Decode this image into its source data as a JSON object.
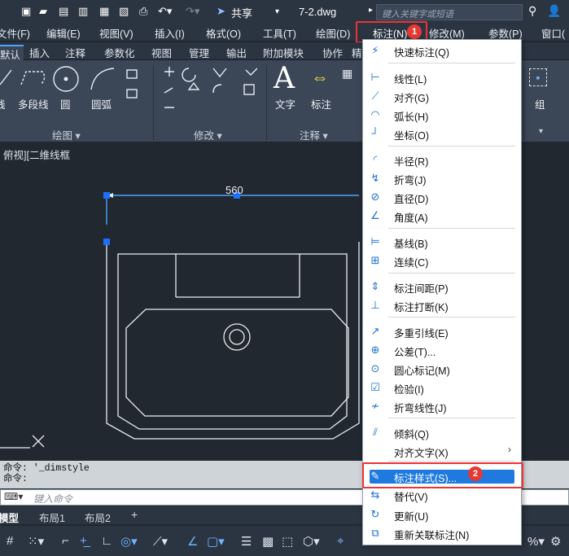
{
  "app": {
    "doc_title": "7-2.dwg",
    "share_label": "共享",
    "search_placeholder": "键入关键字或短语"
  },
  "menubar": [
    "文件(F)",
    "编辑(E)",
    "视图(V)",
    "插入(I)",
    "格式(O)",
    "工具(T)",
    "绘图(D)",
    "标注(N)",
    "修改(M)",
    "参数(P)",
    "窗口("
  ],
  "ribbon_tabs": [
    "默认",
    "插入",
    "注释",
    "参数化",
    "视图",
    "管理",
    "输出",
    "附加模块",
    "协作",
    "精"
  ],
  "ribbon": {
    "draw_buttons": [
      "线",
      "多段线",
      "圆",
      "圆弧"
    ],
    "annotate_buttons": [
      "文字",
      "标注"
    ],
    "group_button": "组",
    "group_titles": {
      "draw": "绘图 ▾",
      "modify": "修改 ▾",
      "annotate": "注释 ▾"
    }
  },
  "viewport": {
    "label": "俯视][二维线框",
    "dimension_text": "560"
  },
  "command": {
    "history": [
      "命令: '_dimstyle",
      "命令:"
    ],
    "placeholder": "键入命令"
  },
  "layout_tabs": [
    "模型",
    "布局1",
    "布局2",
    "+"
  ],
  "dim_menu": {
    "items": [
      {
        "label": "快速标注(Q)",
        "icon": "quick-dimension-icon"
      },
      {
        "label": "线性(L)",
        "icon": "linear-icon"
      },
      {
        "label": "对齐(G)",
        "icon": "aligned-icon"
      },
      {
        "label": "弧长(H)",
        "icon": "arc-length-icon"
      },
      {
        "label": "坐标(O)",
        "icon": "ordinate-icon"
      },
      {
        "label": "半径(R)",
        "icon": "radius-icon"
      },
      {
        "label": "折弯(J)",
        "icon": "jogged-icon"
      },
      {
        "label": "直径(D)",
        "icon": "diameter-icon"
      },
      {
        "label": "角度(A)",
        "icon": "angular-icon"
      },
      {
        "label": "基线(B)",
        "icon": "baseline-icon"
      },
      {
        "label": "连续(C)",
        "icon": "continue-icon"
      },
      {
        "label": "标注间距(P)",
        "icon": "dim-space-icon"
      },
      {
        "label": "标注打断(K)",
        "icon": "dim-break-icon"
      },
      {
        "label": "多重引线(E)",
        "icon": "multileader-icon"
      },
      {
        "label": "公差(T)...",
        "icon": "tolerance-icon"
      },
      {
        "label": "圆心标记(M)",
        "icon": "center-mark-icon"
      },
      {
        "label": "检验(I)",
        "icon": "inspection-icon"
      },
      {
        "label": "折弯线性(J)",
        "icon": "jogged-linear-icon"
      },
      {
        "label": "倾斜(Q)",
        "icon": "oblique-icon"
      },
      {
        "label": "对齐文字(X)",
        "icon": "",
        "submenu": true
      },
      {
        "label": "标注样式(S)...",
        "icon": "dim-style-icon",
        "highlighted": true
      },
      {
        "label": "替代(V)",
        "icon": "override-icon"
      },
      {
        "label": "更新(U)",
        "icon": "update-icon"
      },
      {
        "label": "重新关联标注(N)",
        "icon": "reassociate-icon"
      }
    ]
  },
  "annotations": {
    "step1": "1",
    "step2": "2"
  },
  "colors": {
    "accent": "#1f7ae0",
    "highlight_box": "#e33333",
    "badge": "#e53935",
    "dimension_line": "#4aa3ff"
  }
}
